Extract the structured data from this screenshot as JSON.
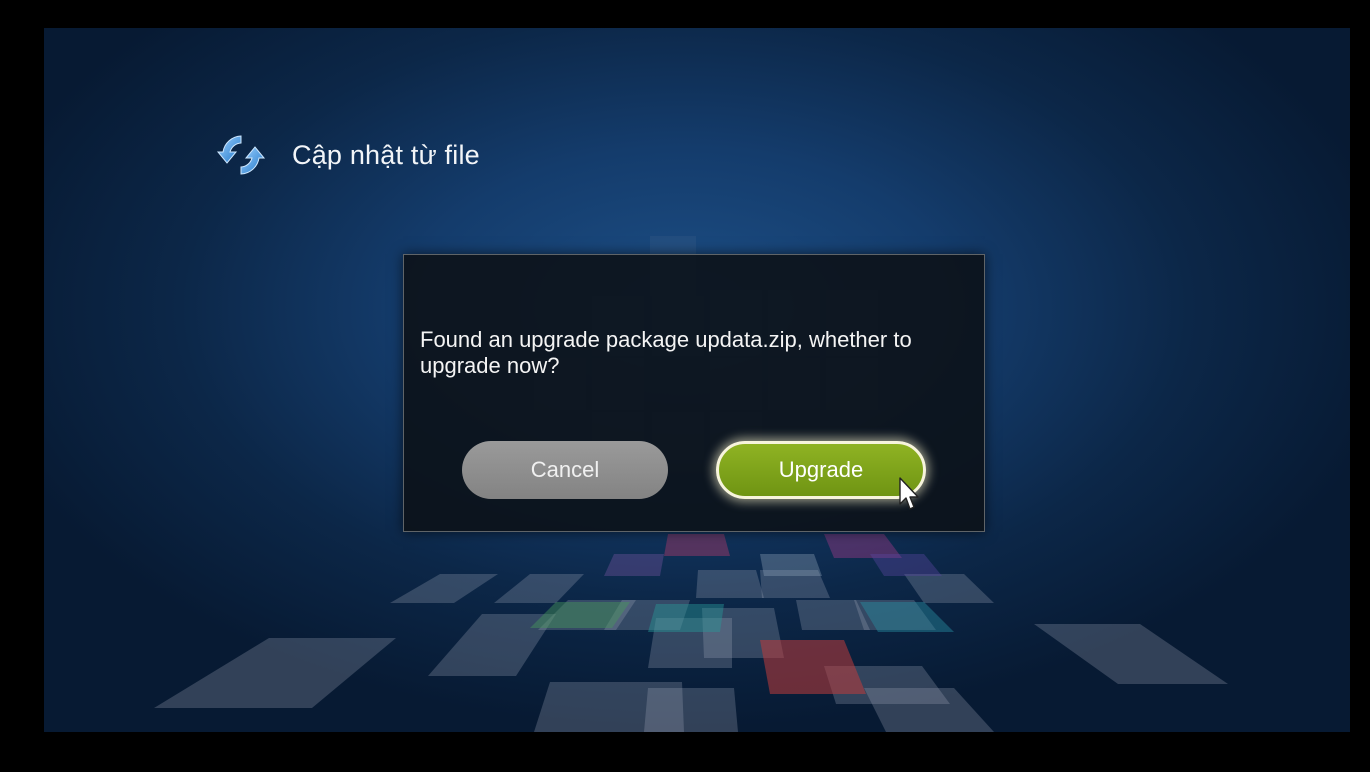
{
  "header": {
    "icon": "refresh-update-icon",
    "title": "Cập nhật từ file"
  },
  "dialog": {
    "message": "Found an upgrade package updata.zip, whether to upgrade now?",
    "buttons": {
      "cancel_label": "Cancel",
      "upgrade_label": "Upgrade"
    },
    "focused_button": "Upgrade"
  },
  "colors": {
    "background": "#143c6c",
    "upgrade_button": "#7ea31b",
    "cancel_button": "#8f8f8f",
    "focus_glow": "#f7f4dc"
  },
  "cursor": {
    "icon": "mouse-pointer-icon"
  }
}
